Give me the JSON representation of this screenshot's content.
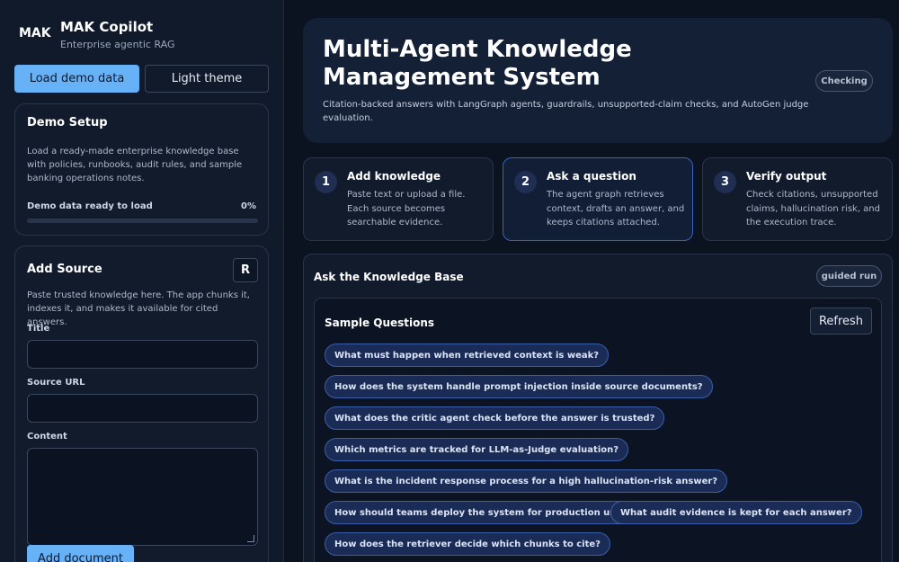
{
  "sidebar": {
    "brand_mark": "MAK",
    "brand_name": "MAK Copilot",
    "brand_sub": "Enterprise agentic RAG",
    "load_demo_label": "Load demo data",
    "theme_toggle_label": "Light theme",
    "demo_setup": {
      "title": "Demo Setup",
      "description": "Load a ready-made enterprise knowledge base with policies, runbooks, audit rules, and sample banking operations notes.",
      "progress_label": "Demo data ready to load",
      "progress_value": "0%",
      "progress_fraction": 0
    },
    "add_source": {
      "title": "Add Source",
      "r_button_label": "R",
      "description": "Paste trusted knowledge here. The app chunks it, indexes it, and makes it available for cited answers.",
      "title_label": "Title",
      "title_value": "",
      "url_label": "Source URL",
      "url_value": "",
      "content_label": "Content",
      "content_value": "",
      "submit_label": "Add document"
    }
  },
  "hero": {
    "title": "Multi-Agent Knowledge Management System",
    "description": "Citation-backed answers with LangGraph agents, guardrails, unsupported-claim checks, and AutoGen judge evaluation.",
    "status_badge": "Checking"
  },
  "steps": [
    {
      "number": "1",
      "title": "Add knowledge",
      "description": "Paste text or upload a file. Each source becomes searchable evidence."
    },
    {
      "number": "2",
      "title": "Ask a question",
      "description": "The agent graph retrieves context, drafts an answer, and keeps citations attached."
    },
    {
      "number": "3",
      "title": "Verify output",
      "description": "Check citations, unsupported claims, hallucination risk, and the execution trace."
    }
  ],
  "ask_panel": {
    "title": "Ask the Knowledge Base",
    "mode_badge": "guided run",
    "samples_title": "Sample Questions",
    "refresh_label": "Refresh",
    "questions": [
      "What must happen when retrieved context is weak?",
      "How does the system handle prompt injection inside source documents?",
      "What does the critic agent check before the answer is trusted?",
      "Which metrics are tracked for LLM-as-Judge evaluation?",
      "What is the incident response process for a high hallucination-risk answer?",
      "How should teams deploy the system for production use?",
      "What audit evidence is kept for each answer?",
      "How does the retriever decide which chunks to cite?"
    ]
  },
  "colors": {
    "background": "#0b1220",
    "sidebar": "#101a2b",
    "accent": "#67b1f7",
    "chip_bg": "#1a2c55",
    "active_border": "#3b62c0"
  }
}
